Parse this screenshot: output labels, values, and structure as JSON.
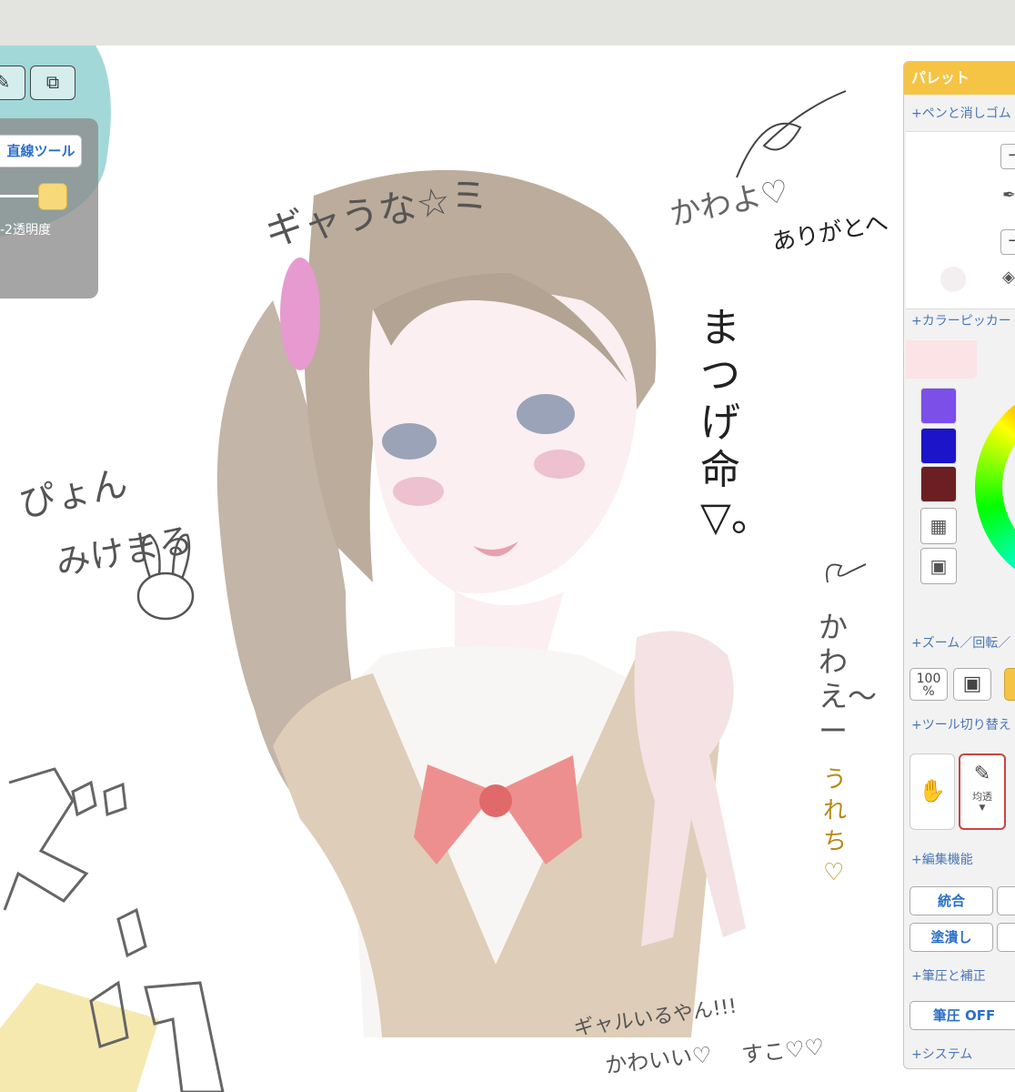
{
  "toolbar": {
    "line_tool_label": "直線ツール",
    "opacity_label": "-2透明度",
    "pen_icon_name": "pen-tool-icon",
    "transform_icon_name": "transform-icon"
  },
  "palette": {
    "title": "パレット",
    "sections": {
      "pen_eraser": "+ペンと消しゴム",
      "color_picker": "+カラーピッカー",
      "zoom_rotate": "+ズーム／回転／",
      "tool_switch": "+ツール切り替え",
      "edit": "+編集機能",
      "pressure": "+筆圧と補正",
      "system": "+システム"
    },
    "swatches": [
      "#7b4fe8",
      "#1c14c8",
      "#6b1f22"
    ],
    "zoom_100_label": "100",
    "zoom_percent": "%",
    "tool_pen_label": "均透",
    "merge_label": "統合",
    "fill_label": "塗潰し",
    "pressure_label": "筆圧 OFF"
  },
  "canvas_text": {
    "t1": "ギャうな☆ミ",
    "t2": "かわよ♡",
    "t3": "ありがとへ",
    "t4": "まつげ命▽。",
    "t5": "ぴょん",
    "t6": "みけまる",
    "t7": "かわえ〜ー",
    "t8": "うれち♡",
    "t9": "ギャルいるやん!!!",
    "t10": "かわいい♡",
    "t11": "すこ♡♡"
  },
  "colors": {
    "accent_yellow": "#f6c445",
    "link_blue": "#4a77b5",
    "hair": "#b4a595",
    "vest": "#d7c4ac",
    "bow": "#e77373"
  }
}
